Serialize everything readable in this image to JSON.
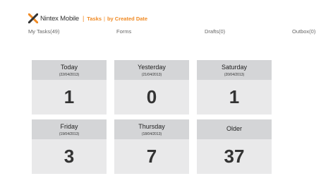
{
  "header": {
    "app_name": "Nintex Mobile",
    "separator": "|",
    "crumb_section": "Tasks",
    "crumb_separator": "|",
    "crumb_view": "by Created Date",
    "logo_icon": "nintex-x-logo",
    "accent_color": "#f08a24"
  },
  "nav": {
    "my_tasks": "My Tasks(49)",
    "forms": "Forms",
    "drafts": "Drafts(0)",
    "outbox": "Outbox(0)"
  },
  "tiles": [
    {
      "title": "Today",
      "date": "(22/04/2013)",
      "count": "1"
    },
    {
      "title": "Yesterday",
      "date": "(21/04/2013)",
      "count": "0"
    },
    {
      "title": "Saturday",
      "date": "(20/04/2013)",
      "count": "1"
    },
    {
      "title": "Friday",
      "date": "(19/04/2013)",
      "count": "3"
    },
    {
      "title": "Thursday",
      "date": "(18/04/2013)",
      "count": "7"
    },
    {
      "title": "Older",
      "count": "37"
    }
  ]
}
